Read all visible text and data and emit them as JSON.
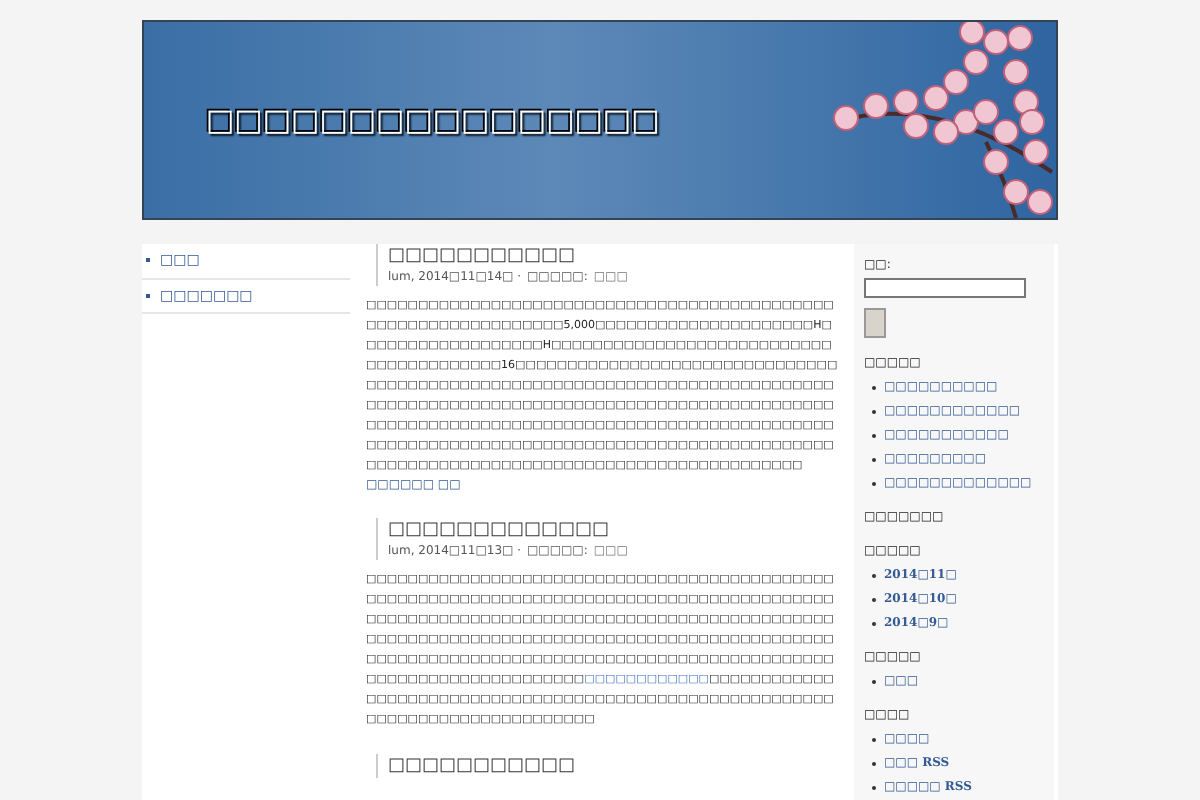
{
  "header": {
    "title": "□□□□□□□□□□□□□□□□"
  },
  "nav": [
    {
      "label": "□□□",
      "selected": false
    },
    {
      "label": "□□□□□□□",
      "selected": false
    }
  ],
  "posts": [
    {
      "title": "□□□□□□□□□□□",
      "date": "lum, 2014□11□14□ ·",
      "category_label": "□□□□□:",
      "category": "□□□",
      "body": [
        {
          "kind": "text",
          "text": "□□□□□□□□□□□□□□□□□□□□□□□□□□□□□□□□□□□□□□□□□□□□□□□□□□□□□□□□□□□□□□□□5,000□□□□□□□□□□□□□□□□□□□□□H□□□□□□□□□□□□□□□□□□H□□□□□□□□□□□□□□□□□□□□□□□□□□□□□□□□□□□□□□□□16□□□□□□□□□□□□□□□□□□□□□□□□□□□□□□□□□□□□□□□□□□□□□□□□□□□□□□□□□□□□□□□□□□□□□□□□□□□□□□□□□□□□□□□□□□□□□□□□□□□□□□□□□□□□□□□□□□□□□□□□□□□□□□□□□□□□□□□□□□□□□□□□□□□□□□□□□□□□□□□□□□□□□□□□□□□□□□□□□□□□□□□□□□□□□□□□□□□□□□□□□□□□□□□□□□□□□□□□□□□□□□□□□□□□□□□□□□□□□□□□□□□□□□□□□□□□□"
        }
      ],
      "more": "□□□□□□ □□"
    },
    {
      "title": "□□□□□□□□□□□□□",
      "date": "lum, 2014□11□13□ ·",
      "category_label": "□□□□□:",
      "category": "□□□",
      "body": [
        {
          "kind": "text",
          "text": "□□□□□□□□□□□□□□□□□□□□□□□□□□□□□□□□□□□□□□□□□□□□□□□□□□□□□□□□□□□□□□□□□□□□□□□□□□□□□□□□□□□□□□□□□□□□□□□□□□□□□□□□□□□□□□□□□□□□□□□□□□□□□□□□□□□□□□□□□□□□□□□□□□□□□□□□□□□□□□□□□□□□□□□□□□□□□□□□□□□□□□□□□□□□□□□□□□□□□□□□□□□□□□□□□□□□□□□□□□□□□□□□□□□□□□□□□□□□□□□□□□□□□□"
        },
        {
          "kind": "link",
          "text": "□□□□□□□□□□□□"
        },
        {
          "kind": "text",
          "text": "□□□□□□□□□□□□□□□□□□□□□□□□□□□□□□□□□□□□□□□□□□□□□□□□□□□□□□□□□□□□□□□□□□□□□□□□□□□□□□□"
        }
      ]
    },
    {
      "title": "□□□□□□□□□□□"
    }
  ],
  "sidebar": {
    "search_label": "□□:",
    "widgets": [
      {
        "title": "□□□□□",
        "items": [
          "□□□□□□□□□□",
          "□□□□□□□□□□□□",
          "□□□□□□□□□□□",
          "□□□□□□□□□",
          "□□□□□□□□□□□□□"
        ]
      },
      {
        "title": "□□□□□□□"
      },
      {
        "title": "□□□□□",
        "items": [
          "2014□11□",
          "2014□10□",
          "2014□9□"
        ]
      },
      {
        "title": "□□□□□",
        "items": [
          "□□□"
        ]
      },
      {
        "title": "□□□□",
        "items": [
          "□□□□",
          "□□□ RSS",
          "□□□□□ RSS"
        ]
      }
    ]
  }
}
